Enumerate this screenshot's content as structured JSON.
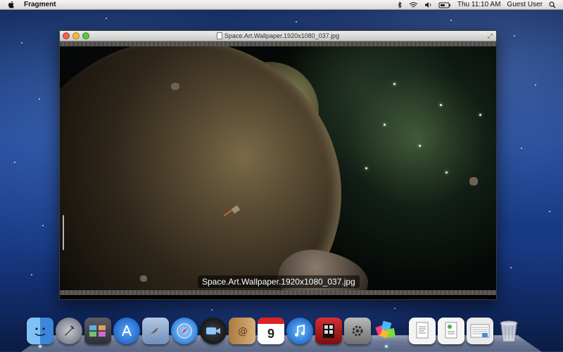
{
  "menubar": {
    "apple_icon": "apple-icon",
    "app_name": "Fragment",
    "clock": "Thu 11:10 AM",
    "user": "Guest User",
    "status_icons": [
      "bluetooth-icon",
      "wifi-icon",
      "volume-icon",
      "battery-icon",
      "spotlight-icon"
    ]
  },
  "window": {
    "title": "Space.Art.Wallpaper.1920x1080_037.jpg",
    "caption": "Space.Art.Wallpaper.1920x1080_037.jpg",
    "controls": [
      "close",
      "minimize",
      "zoom"
    ],
    "fullscreen_icon": "fullscreen-arrows-icon"
  },
  "dock": {
    "apps": [
      {
        "name": "finder",
        "icon": "finder-icon",
        "color": "#5aa0e8",
        "running": true
      },
      {
        "name": "launchpad",
        "icon": "rocket-icon",
        "color": "#8a8d95",
        "running": false
      },
      {
        "name": "mission-control",
        "icon": "mission-control-icon",
        "color": "#4a4a55",
        "running": false
      },
      {
        "name": "app-store",
        "icon": "app-store-icon",
        "color": "#2e7be6",
        "running": false
      },
      {
        "name": "mail",
        "icon": "mail-stamp-icon",
        "color": "#8aa3c4",
        "running": false
      },
      {
        "name": "safari",
        "icon": "compass-icon",
        "color": "#3d8fe0",
        "running": false
      },
      {
        "name": "facetime",
        "icon": "camera-icon",
        "color": "#222",
        "running": false
      },
      {
        "name": "address-book",
        "icon": "address-book-icon",
        "color": "#c99a55",
        "running": false
      },
      {
        "name": "ical",
        "icon": "calendar-icon",
        "color": "#ffffff",
        "running": false,
        "label": "9"
      },
      {
        "name": "itunes",
        "icon": "music-note-icon",
        "color": "#2a7fd8",
        "running": false
      },
      {
        "name": "photo-booth",
        "icon": "photo-booth-icon",
        "color": "#b51f1f",
        "running": false
      },
      {
        "name": "system-preferences",
        "icon": "gear-icon",
        "color": "#8a8a8a",
        "running": false
      },
      {
        "name": "fragment",
        "icon": "fragment-icon",
        "color": "#ff4fa0",
        "running": true
      }
    ],
    "stacks": [
      {
        "name": "documents-stack",
        "icon": "documents-icon"
      },
      {
        "name": "downloads-stack",
        "icon": "downloads-icon"
      },
      {
        "name": "applications-stack",
        "icon": "applications-folder-icon"
      },
      {
        "name": "trash",
        "icon": "trash-icon"
      }
    ]
  }
}
